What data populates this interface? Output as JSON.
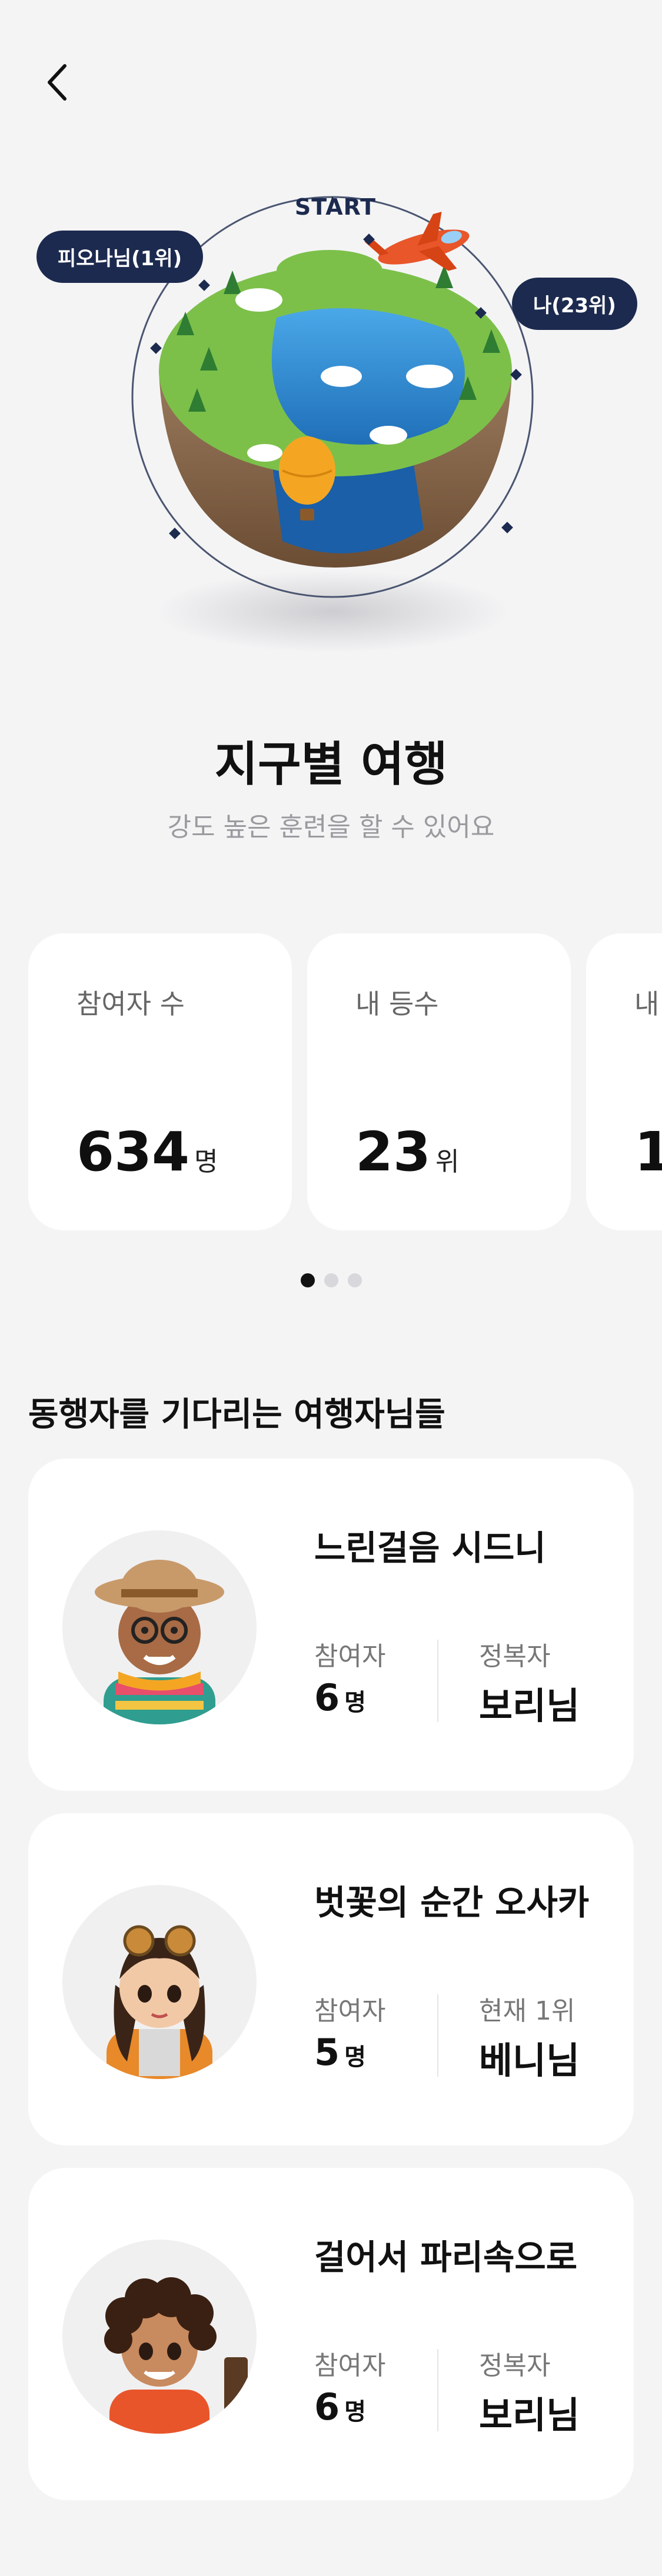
{
  "nav": {
    "back_icon": "chevron-left-icon"
  },
  "hero": {
    "start_label": "START",
    "leader_pill": "피오나님(1위)",
    "me_pill": "나(23위)",
    "title": "지구별 여행",
    "subtitle": "강도 높은 훈련을 할 수 있어요"
  },
  "stats": [
    {
      "label": "참여자 수",
      "value": "634",
      "unit": "명"
    },
    {
      "label": "내 등수",
      "value": "23",
      "unit": "위"
    },
    {
      "label": "내",
      "value": "1",
      "unit": ""
    }
  ],
  "pager": {
    "count": 3,
    "active_index": 0
  },
  "section": {
    "title": "동행자를 기다리는 여행자님들"
  },
  "trips": [
    {
      "title": "느린걸음 시드니",
      "participants_label": "참여자",
      "participants_value": "6",
      "participants_unit": "명",
      "second_label": "정복자",
      "second_value": "보리님"
    },
    {
      "title": "벗꽃의 순간 오사카",
      "participants_label": "참여자",
      "participants_value": "5",
      "participants_unit": "명",
      "second_label": "현재 1위",
      "second_value": "베니님"
    },
    {
      "title": "걸어서 파리속으로",
      "participants_label": "참여자",
      "participants_value": "6",
      "participants_unit": "명",
      "second_label": "정복자",
      "second_value": "보리님"
    }
  ],
  "colors": {
    "background": "#f4f4f5",
    "navy": "#1c2a4f",
    "card": "#ffffff",
    "muted": "#9a9a9f"
  }
}
